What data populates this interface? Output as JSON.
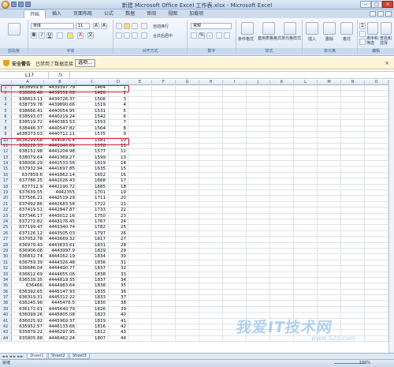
{
  "window": {
    "title": "新建 Microsoft Office Excel 工作表.xlsx - Microsoft Excel",
    "min": "−",
    "max": "□",
    "close": "×"
  },
  "ribbon": {
    "tabs": [
      "开始",
      "插入",
      "页面布局",
      "公式",
      "数据",
      "审阅",
      "视图",
      "加载项"
    ],
    "active_tab": 0,
    "font_name": "宋体",
    "font_size": "11",
    "wrap_text": "自动换行",
    "merge_center": "合并后居中",
    "number_format": "常规",
    "conditional_format": "条件格式",
    "table_format": "套用表格格式",
    "cell_styles": "单元格样式",
    "insert": "插入",
    "delete": "删除",
    "format": "格式",
    "sort_filter": "排序和筛选",
    "find_select": "查找和选择",
    "groups": {
      "clipboard": "剪贴板",
      "font": "字体",
      "alignment": "对齐方式",
      "number": "数字",
      "styles": "样式",
      "cells": "单元格",
      "editing": "编辑"
    }
  },
  "security_bar": {
    "title": "安全警告",
    "message": "已禁用了数据连接",
    "options_button": "选项..."
  },
  "formula_bar": {
    "name_box": "L17",
    "fx": "fx",
    "content": ""
  },
  "columns": [
    "A",
    "B",
    "C",
    "D",
    "E",
    "F",
    "G",
    "H",
    "I",
    "J",
    "K",
    "L",
    "M",
    "N",
    "O"
  ],
  "rows": [
    {
      "n": "1",
      "a": "a638959.8",
      "b": "4439397.79",
      "c": "1464",
      "d": "1"
    },
    {
      "n": "2",
      "a": "638886.46",
      "b": "4439552.08",
      "c": "1480",
      "d": "2"
    },
    {
      "n": "3",
      "a": "638813.11",
      "b": "4439726.37",
      "c": "1506",
      "d": "3"
    },
    {
      "n": "4",
      "a": "638739.76",
      "b": "4439890.66",
      "c": "1519",
      "d": "4"
    },
    {
      "n": "5",
      "a": "638666.41",
      "b": "4440054.95",
      "c": "1531",
      "d": "5"
    },
    {
      "n": "6",
      "a": "638593.07",
      "b": "4440219.24",
      "c": "1542",
      "d": "6"
    },
    {
      "n": "7",
      "a": "638519.72",
      "b": "4440383.53",
      "c": "1553",
      "d": "7"
    },
    {
      "n": "8",
      "a": "638446.37",
      "b": "4440547.82",
      "c": "1564",
      "d": "8"
    },
    {
      "n": "9",
      "a": "a638373.03",
      "b": "4440712.11",
      "c": "1575",
      "d": "9"
    },
    {
      "n": "10",
      "a": "b638299.68",
      "b": "4440876.4",
      "c": "1581",
      "d": "10"
    },
    {
      "n": "11",
      "a": "638226.33",
      "b": "4441040.69",
      "c": "1578",
      "d": "11"
    },
    {
      "n": "12",
      "a": "638152.98",
      "b": "4441204.98",
      "c": "1577",
      "d": "12"
    },
    {
      "n": "13",
      "a": "638079.64",
      "b": "4441369.27",
      "c": "1599",
      "d": "13"
    },
    {
      "n": "14",
      "a": "638006.29",
      "b": "4441533.56",
      "c": "1619",
      "d": "14"
    },
    {
      "n": "15",
      "a": "637932.94",
      "b": "4441697.85",
      "c": "1635",
      "d": "15"
    },
    {
      "n": "16",
      "a": "637859.6",
      "b": "4441862.14",
      "c": "1652",
      "d": "16"
    },
    {
      "n": "17",
      "a": "637786.25",
      "b": "4442026.43",
      "c": "1668",
      "d": "17"
    },
    {
      "n": "18",
      "a": "637712.9",
      "b": "4442190.72",
      "c": "1685",
      "d": "18"
    },
    {
      "n": "19",
      "a": "637639.55",
      "b": "4442355",
      "c": "1701",
      "d": "19"
    },
    {
      "n": "20",
      "a": "637566.21",
      "b": "4442519.29",
      "c": "1711",
      "d": "20"
    },
    {
      "n": "21",
      "a": "637492.86",
      "b": "4442683.58",
      "c": "1722",
      "d": "21"
    },
    {
      "n": "22",
      "a": "637419.51",
      "b": "4442847.87",
      "c": "1733",
      "d": "22"
    },
    {
      "n": "23",
      "a": "637346.17",
      "b": "4443012.16",
      "c": "1750",
      "d": "23"
    },
    {
      "n": "24",
      "a": "637272.82",
      "b": "4443176.45",
      "c": "1767",
      "d": "24"
    },
    {
      "n": "25",
      "a": "637199.47",
      "b": "4443340.74",
      "c": "1782",
      "d": "25"
    },
    {
      "n": "26",
      "a": "637126.12",
      "b": "4443505.03",
      "c": "1797",
      "d": "26"
    },
    {
      "n": "27",
      "a": "637052.78",
      "b": "4443669.32",
      "c": "1817",
      "d": "27"
    },
    {
      "n": "28",
      "a": "636979.43",
      "b": "4443833.61",
      "c": "1831",
      "d": "28"
    },
    {
      "n": "29",
      "a": "636906.08",
      "b": "4443997.9",
      "c": "1829",
      "d": "29"
    },
    {
      "n": "30",
      "a": "636832.74",
      "b": "4444162.19",
      "c": "1834",
      "d": "30"
    },
    {
      "n": "31",
      "a": "636759.39",
      "b": "4444326.48",
      "c": "1836",
      "d": "31"
    },
    {
      "n": "32",
      "a": "636686.04",
      "b": "4444490.77",
      "c": "1837",
      "d": "32"
    },
    {
      "n": "33",
      "a": "636612.69",
      "b": "4444655.06",
      "c": "1838",
      "d": "33"
    },
    {
      "n": "34",
      "a": "636539.35",
      "b": "4444819.35",
      "c": "1837",
      "d": "34"
    },
    {
      "n": "35",
      "a": "636466",
      "b": "4444983.64",
      "c": "1838",
      "d": "35"
    },
    {
      "n": "36",
      "a": "636392.65",
      "b": "4445147.93",
      "c": "1835",
      "d": "36"
    },
    {
      "n": "37",
      "a": "636319.31",
      "b": "4445312.22",
      "c": "1833",
      "d": "37"
    },
    {
      "n": "38",
      "a": "636245.96",
      "b": "4445476.5",
      "c": "1830",
      "d": "38"
    },
    {
      "n": "39",
      "a": "636172.61",
      "b": "4445640.79",
      "c": "1826",
      "d": "39"
    },
    {
      "n": "40",
      "a": "636099.26",
      "b": "4445805.08",
      "c": "1823",
      "d": "40"
    },
    {
      "n": "41",
      "a": "636025.92",
      "b": "4445969.37",
      "c": "1819",
      "d": "41"
    },
    {
      "n": "42",
      "a": "635952.57",
      "b": "4446133.66",
      "c": "1816",
      "d": "42"
    },
    {
      "n": "43",
      "a": "635879.22",
      "b": "4446297.95",
      "c": "1812",
      "d": "43"
    },
    {
      "n": "44",
      "a": "635805.88",
      "b": "4446462.24",
      "c": "1807",
      "d": "44"
    }
  ],
  "sheets": [
    "Sheet1",
    "Sheet2",
    "Sheet3"
  ],
  "status": {
    "ready": "就绪",
    "zoom": "100%"
  },
  "watermark": {
    "text": "我爱IT技术网",
    "sub": "www.52ij.com"
  },
  "colors": {
    "highlight": "#c8202b",
    "accent": "#1e395b"
  }
}
